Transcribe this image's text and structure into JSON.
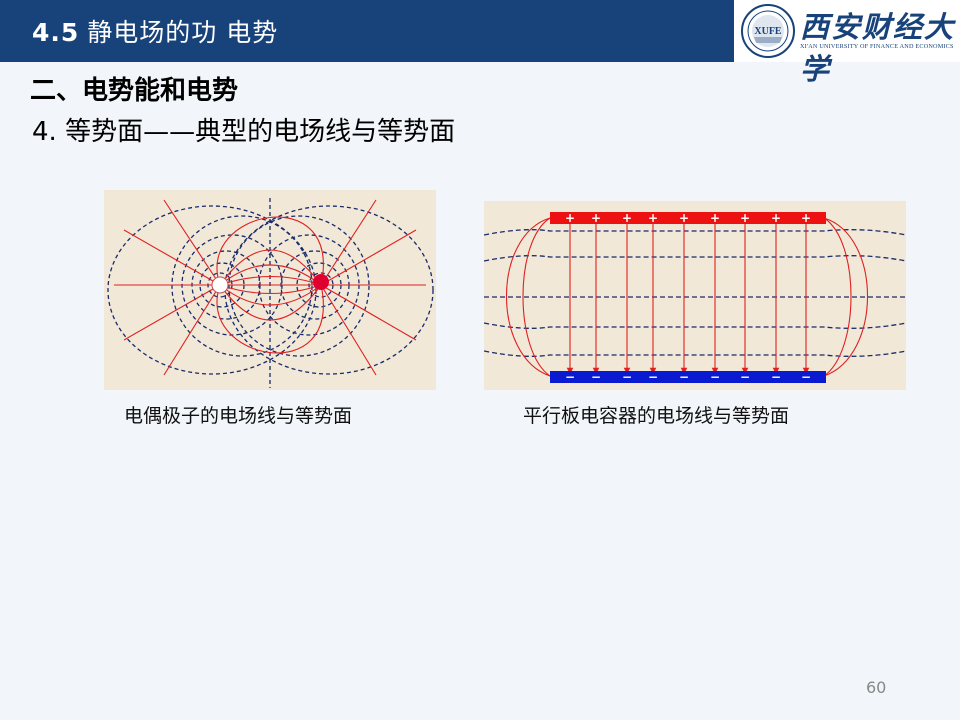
{
  "header": {
    "section_number": "4.5",
    "section_title": "静电场的功 电势"
  },
  "logo": {
    "seal_text": "XUFE",
    "name_cn": "西安财经大学",
    "name_en": "XI'AN UNIVERSITY OF FINANCE AND ECONOMICS"
  },
  "content": {
    "heading": "二、电势能和电势",
    "subheading": "4. 等势面——典型的电场线与等势面"
  },
  "figures": [
    {
      "caption": "电偶极子的电场线与等势面"
    },
    {
      "caption": "平行板电容器的电场线与等势面",
      "plus_sign": "+",
      "minus_sign": "−"
    }
  ],
  "footer": {
    "page_number": "60"
  },
  "colors": {
    "header_bg": "#17427a",
    "field_line": "#e02020",
    "equipotential": "#1a2a6a",
    "positive_plate": "#ee1111",
    "negative_plate": "#0a1ad0"
  }
}
